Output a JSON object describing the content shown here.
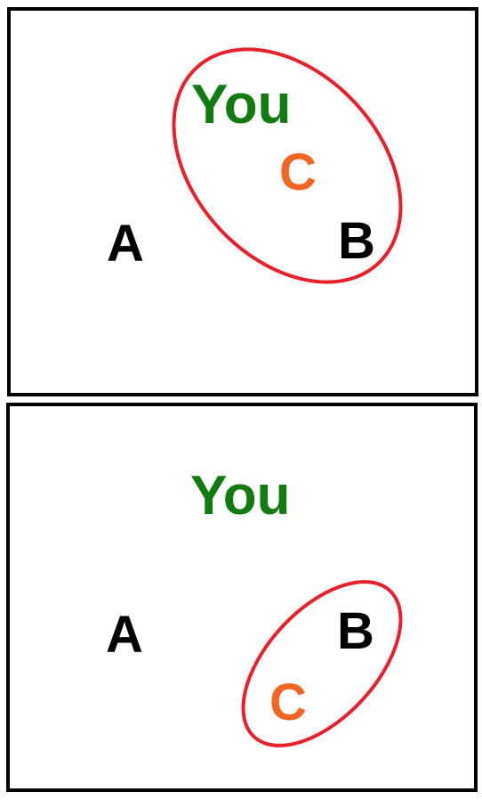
{
  "colors": {
    "you": "#117a11",
    "c": "#f26522",
    "letters": "#000000",
    "ellipse": "#e8202a",
    "frame": "#000000"
  },
  "panels": [
    {
      "you": "You",
      "a": "A",
      "b": "B",
      "c": "C",
      "grouped": [
        "You",
        "C",
        "B"
      ]
    },
    {
      "you": "You",
      "a": "A",
      "b": "B",
      "c": "C",
      "grouped": [
        "B",
        "C"
      ]
    }
  ]
}
